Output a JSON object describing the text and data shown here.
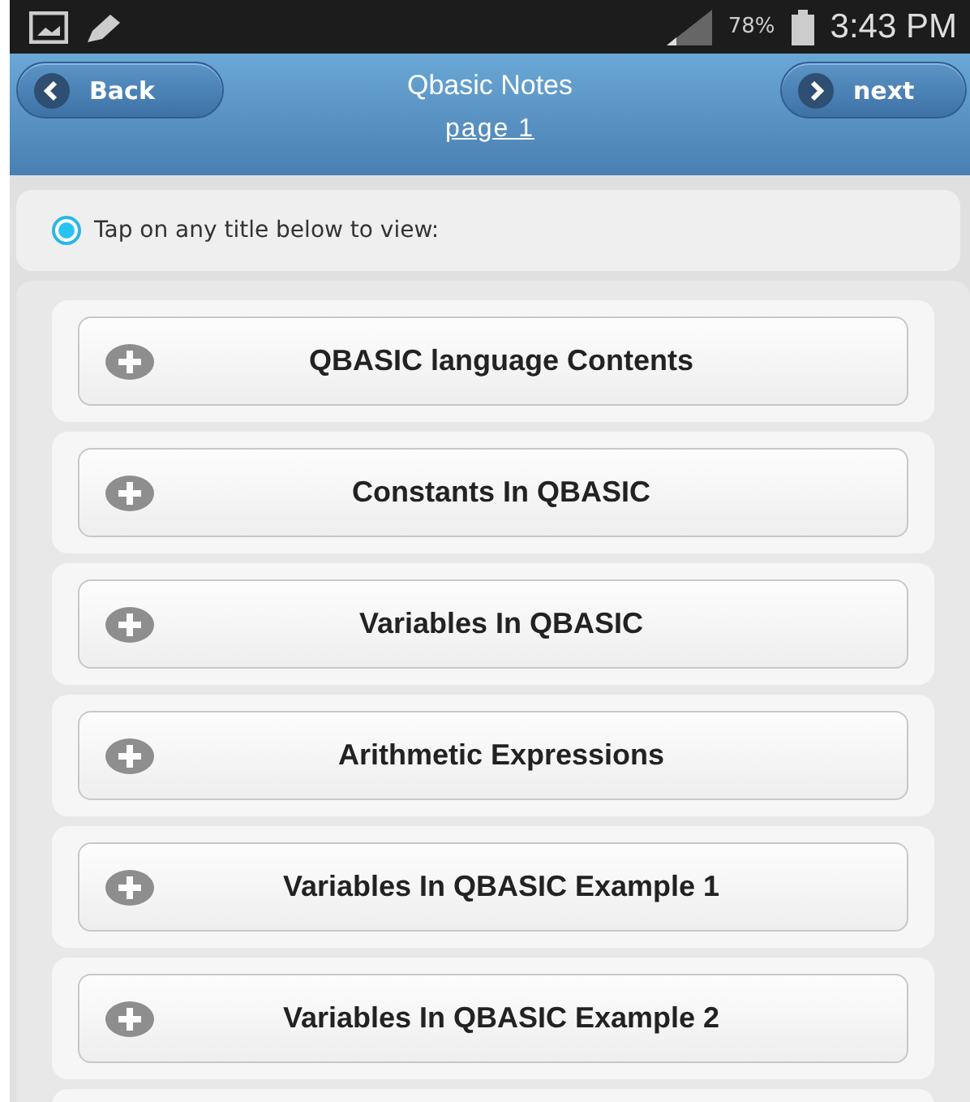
{
  "status_bar": {
    "battery": "78%",
    "time": "3:43 PM"
  },
  "header": {
    "back": "Back",
    "title": "Qbasic Notes",
    "next": "next",
    "page_link": "page 1"
  },
  "info": {
    "text": "Tap on any title below to view:"
  },
  "items": [
    {
      "title": "QBASIC language Contents"
    },
    {
      "title": "Constants In QBASIC"
    },
    {
      "title": "Variables In QBASIC"
    },
    {
      "title": "Arithmetic Expressions"
    },
    {
      "title": "Variables In QBASIC Example 1"
    },
    {
      "title": "Variables In QBASIC Example 2"
    }
  ]
}
